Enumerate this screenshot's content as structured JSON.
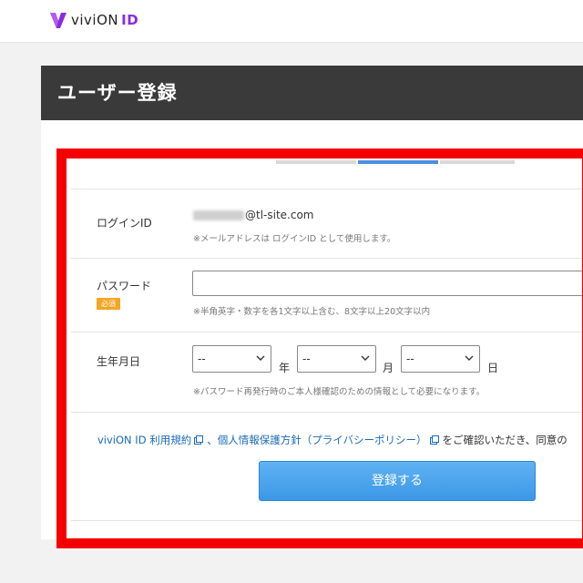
{
  "header": {
    "logo_text": "viviON",
    "logo_id": "ID"
  },
  "page": {
    "title": "ユーザー登録"
  },
  "form": {
    "login_id": {
      "label": "ログインID",
      "value_visible": "@tl-site.com",
      "note": "※メールアドレスは ログインID として使用します。"
    },
    "password": {
      "label": "パスワード",
      "required_badge": "必須",
      "value": "",
      "note": "※半角英字・数字を各1文字以上含む、8文字以上20文字以内"
    },
    "birthdate": {
      "label": "生年月日",
      "year": {
        "value": "--",
        "unit": "年"
      },
      "month": {
        "value": "--",
        "unit": "月"
      },
      "day": {
        "value": "--",
        "unit": "日"
      },
      "note": "※パスワード再発行時のご本人様確認のための情報として必要になります。"
    },
    "agreement": {
      "terms_link": "viviON ID 利用規約",
      "sep": "、",
      "privacy_link": "個人情報保護方針（プライバシーポリシー）",
      "tail": "をご確認いただき、同意の"
    },
    "submit_label": "登録する"
  },
  "colors": {
    "accent": "#8a2be2",
    "title_bar": "#3a3a3a",
    "link": "#1a6ab8",
    "button": "#4aa3ee",
    "required": "#f5a623",
    "highlight_frame": "#f50000"
  },
  "icons": [
    "vivion-logo-icon",
    "external-link-icon",
    "chevron-down-icon"
  ]
}
